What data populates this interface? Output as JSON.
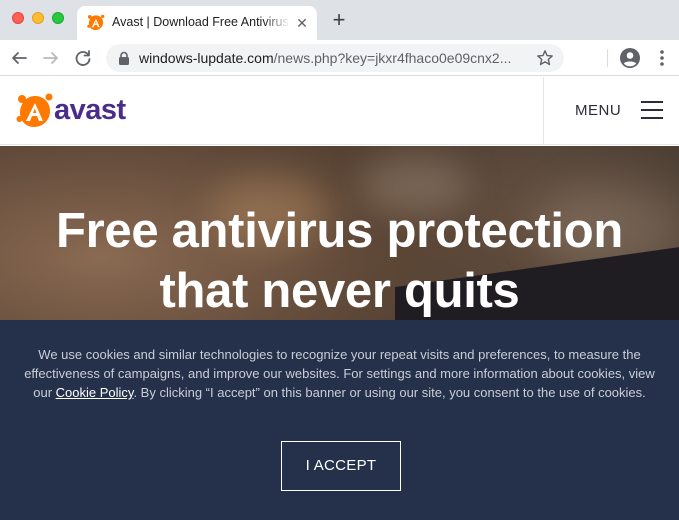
{
  "browser": {
    "tab": {
      "title": "Avast | Download Free Antivirus & VPN",
      "favicon": "avast-logo-icon",
      "close_icon": "close-icon"
    },
    "new_tab_icon": "plus-icon",
    "toolbar": {
      "back_icon": "back-arrow-icon",
      "forward_icon": "forward-arrow-icon",
      "reload_icon": "reload-icon",
      "lock_icon": "lock-icon",
      "url_host": "windows-lupdate.com",
      "url_path": "/news.php?key=jkxr4fhaco0e09cnx2...",
      "bookmark_icon": "star-icon",
      "profile_icon": "account-circle-icon",
      "menu_icon": "kebab-menu-icon"
    }
  },
  "site": {
    "logo_text": "avast",
    "menu_label": "MENU",
    "hero_title_line1": "Free antivirus protection",
    "hero_title_line2": "that never quits",
    "brand_colors": {
      "orange": "#ff7800",
      "purple": "#4b2d89",
      "banner": "#25314a"
    }
  },
  "cookie_banner": {
    "text_before_link": "We use cookies and similar technologies to recognize your repeat visits and preferences, to measure the effectiveness of campaigns, and improve our websites. For settings and more information about cookies, view our ",
    "link_text": "Cookie Policy",
    "text_after_link": ". By clicking “I accept” on this banner or using our site, you consent to the use of cookies.",
    "accept_label": "I ACCEPT"
  }
}
